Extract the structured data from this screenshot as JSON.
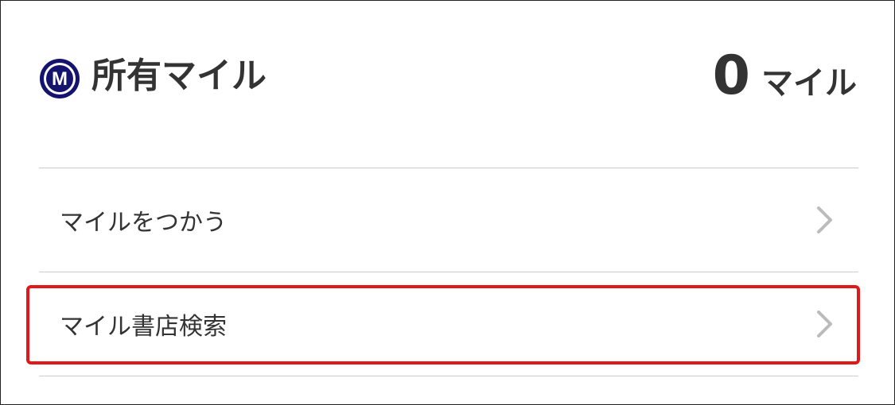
{
  "header": {
    "title": "所有マイル",
    "logo_letter": "M",
    "logo_icon": "mile-m-icon",
    "balance_value": "0",
    "balance_unit": "マイル"
  },
  "menu": {
    "items": [
      {
        "label": "マイルをつかう",
        "icon": "chevron-right-icon"
      },
      {
        "label": "マイル書店検索",
        "icon": "chevron-right-icon",
        "highlighted": true
      }
    ]
  },
  "colors": {
    "text": "#333333",
    "logo_navy": "#14146e",
    "divider": "#cccccc",
    "chevron": "#bbbbbb",
    "highlight": "#e01818"
  }
}
